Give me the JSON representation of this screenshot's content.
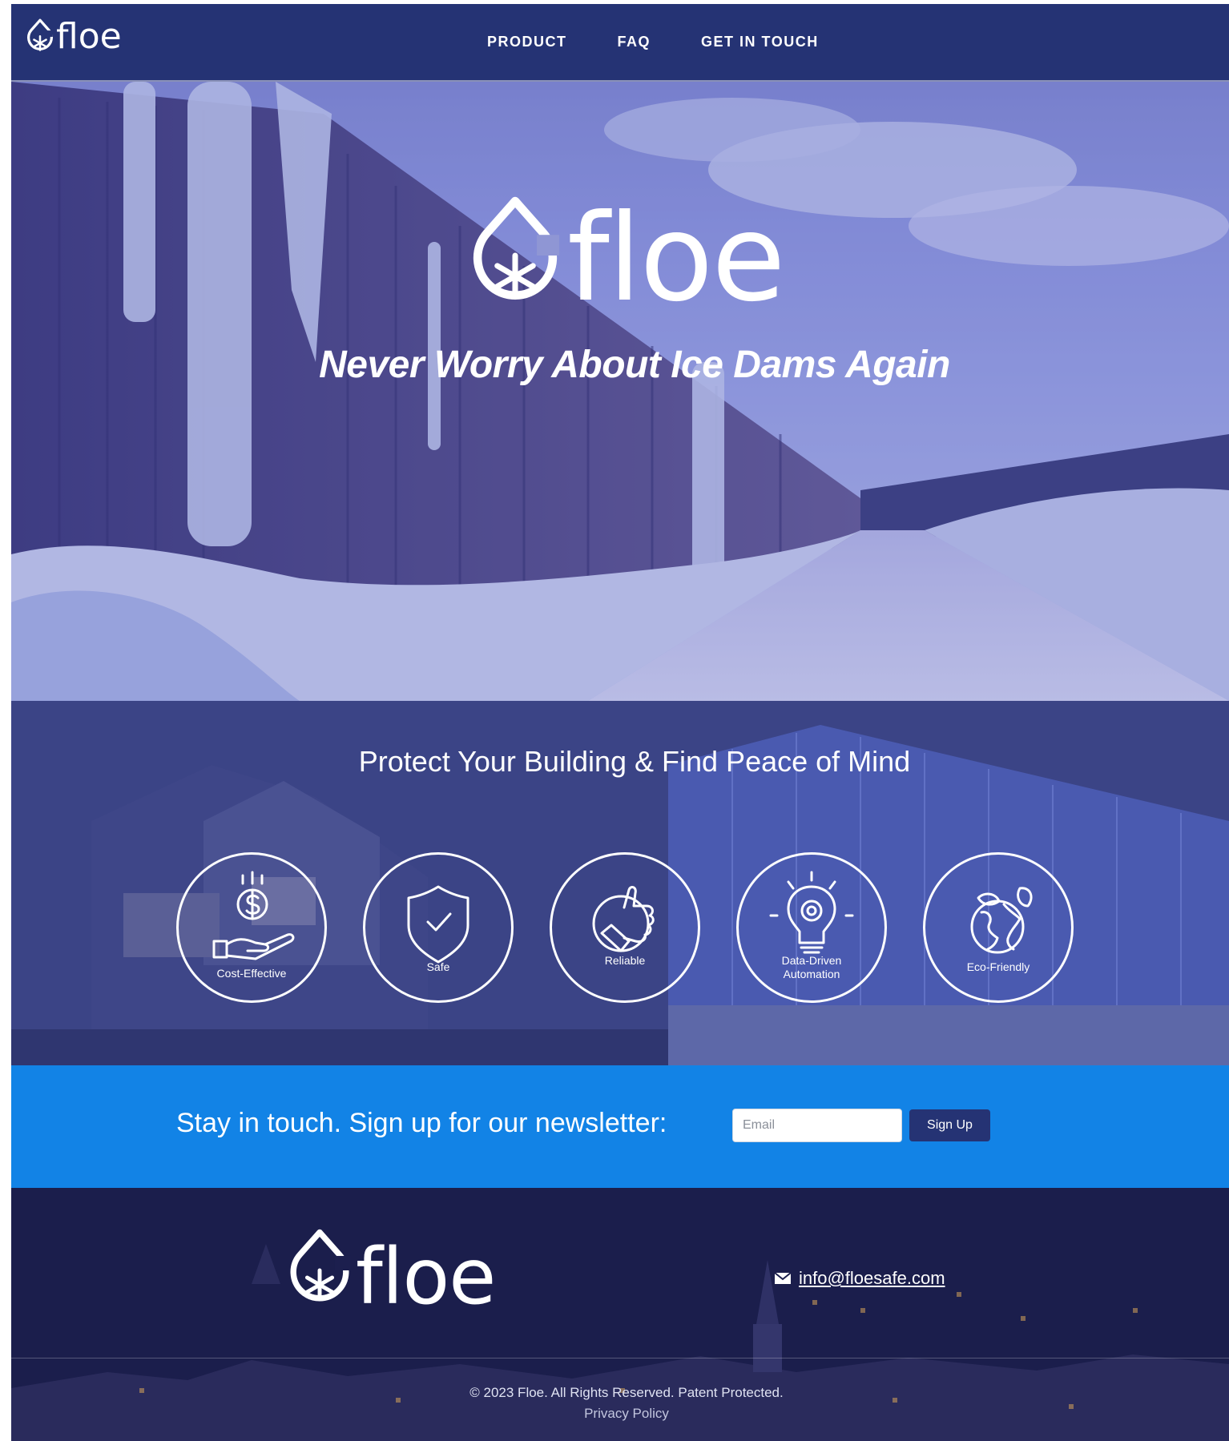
{
  "brand": {
    "name": "floe"
  },
  "nav": {
    "links": [
      {
        "label": "PRODUCT"
      },
      {
        "label": "FAQ"
      },
      {
        "label": "GET IN TOUCH"
      }
    ]
  },
  "hero": {
    "tagline": "Never Worry About Ice Dams Again"
  },
  "features": {
    "title": "Protect Your Building & Find Peace of Mind",
    "items": [
      {
        "label": "Cost-Effective",
        "icon": "hand-dollar-icon"
      },
      {
        "label": "Safe",
        "icon": "shield-check-icon"
      },
      {
        "label": "Reliable",
        "icon": "thumbs-up-icon"
      },
      {
        "label": "Data-Driven\nAutomation",
        "icon": "lightbulb-gear-icon"
      },
      {
        "label": "Eco-Friendly",
        "icon": "globe-leaf-icon"
      }
    ]
  },
  "newsletter": {
    "text": "Stay in touch. Sign up for our newsletter:",
    "email_placeholder": "Email",
    "button_label": "Sign Up"
  },
  "footer": {
    "email": "info@floesafe.com",
    "copyright": "© 2023 Floe. All Rights Reserved. Patent Protected.",
    "privacy_label": "Privacy Policy"
  },
  "colors": {
    "nav_bg": "#253374",
    "newsletter_bg": "#1283e6",
    "button_bg": "#253374",
    "footer_bg": "#1c1f4e"
  }
}
